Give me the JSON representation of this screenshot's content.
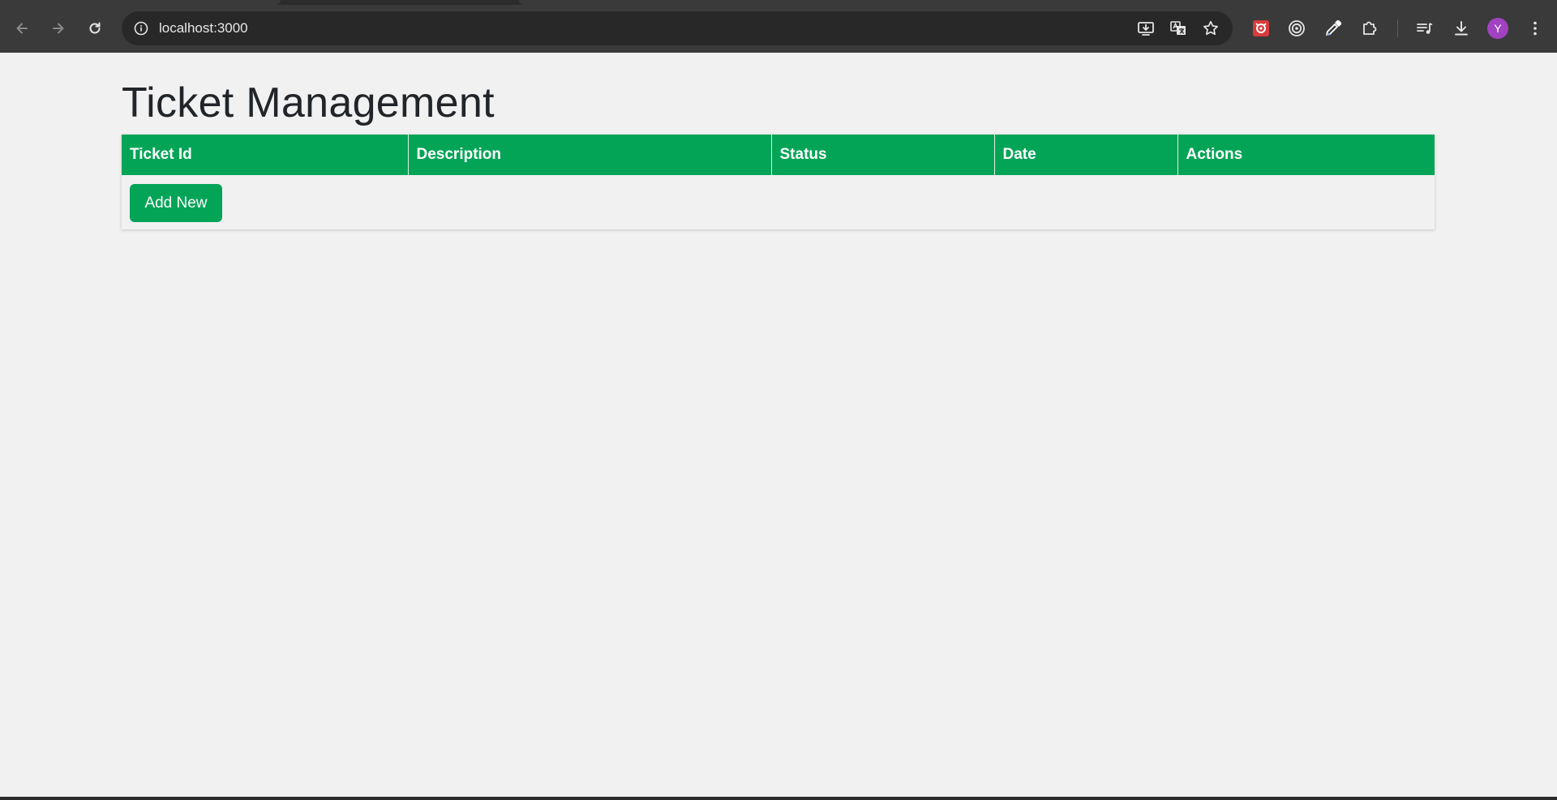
{
  "browser": {
    "url": "localhost:3000",
    "profile_initial": "Y",
    "icons": {
      "back": "arrow-left-icon",
      "forward": "arrow-right-icon",
      "reload": "reload-icon",
      "site_info": "info-icon",
      "install_app": "install-app-icon",
      "translate": "translate-icon",
      "bookmark": "star-icon",
      "extension_1": "extension-red-icon",
      "extension_2": "target-icon",
      "extension_3": "eyedropper-icon",
      "extensions": "puzzle-icon",
      "media": "media-playlist-icon",
      "downloads": "download-icon",
      "menu": "kebab-menu-icon"
    },
    "colors": {
      "frame": "#3a3a3a",
      "omnibox": "#282828",
      "avatar": "#a142c2"
    }
  },
  "page": {
    "title": "Ticket Management",
    "table": {
      "columns": [
        "Ticket Id",
        "Description",
        "Status",
        "Date",
        "Actions"
      ],
      "rows": []
    },
    "add_button_label": "Add New",
    "colors": {
      "accent": "#04a457",
      "background": "#f1f1f1",
      "title_text": "#212529"
    }
  }
}
